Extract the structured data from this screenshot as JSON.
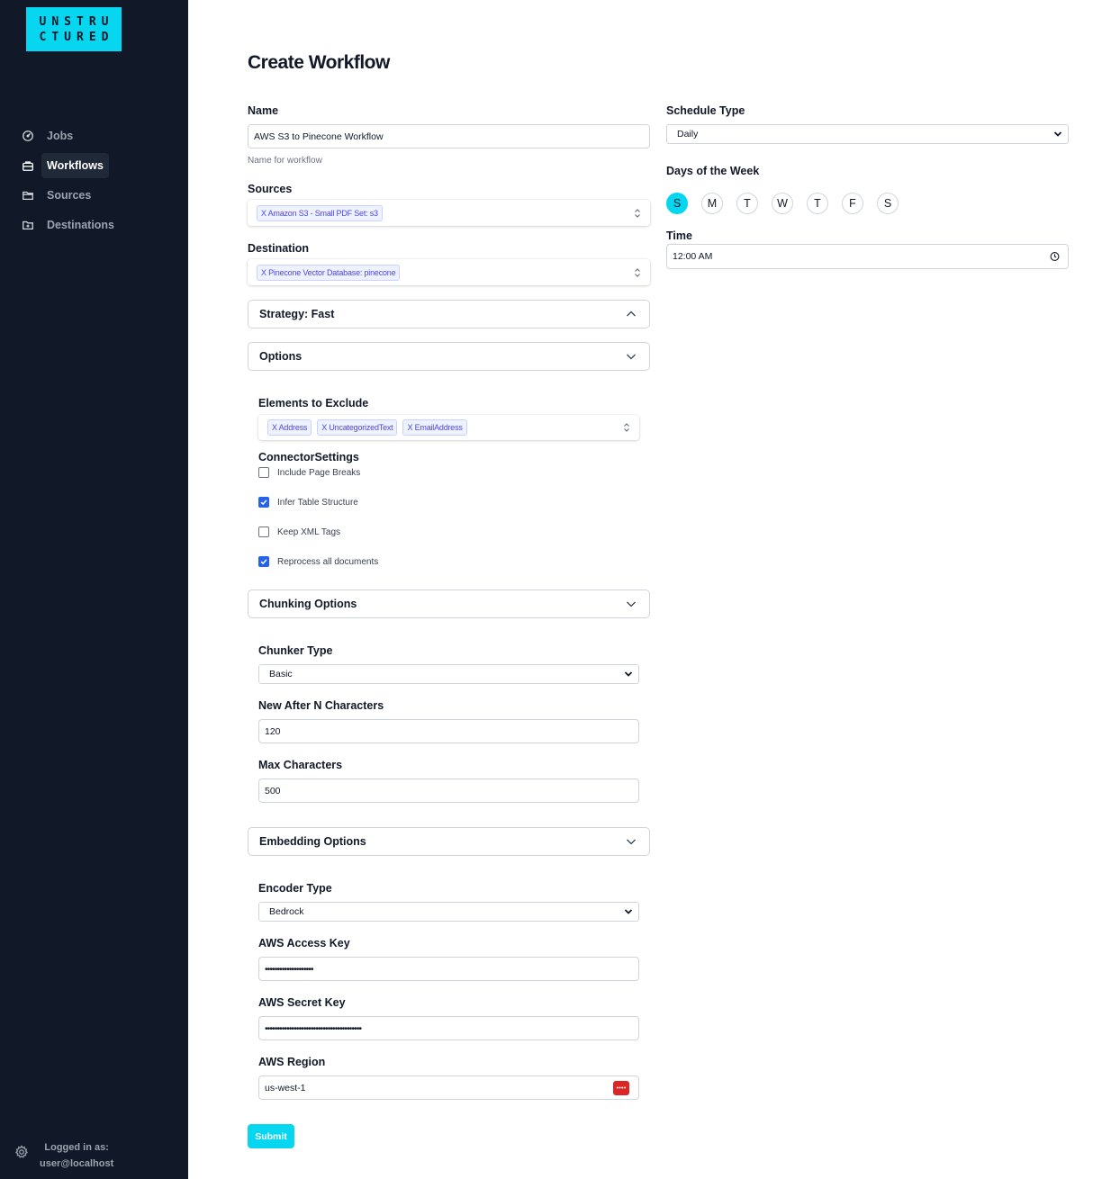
{
  "logo": {
    "line1": "UNSTRU",
    "line2": "CTURED"
  },
  "sidebar": {
    "items": [
      {
        "label": "Jobs",
        "icon": "dashboard-icon",
        "active": false
      },
      {
        "label": "Workflows",
        "icon": "briefcase-icon",
        "active": true
      },
      {
        "label": "Sources",
        "icon": "folder-icon",
        "active": false
      },
      {
        "label": "Destinations",
        "icon": "folder-plus-icon",
        "active": false
      }
    ],
    "footer": {
      "line1": "Logged in as:",
      "line2": "user@localhost"
    }
  },
  "page": {
    "title": "Create Workflow"
  },
  "form": {
    "name": {
      "label": "Name",
      "value": "AWS S3 to Pinecone Workflow",
      "help": "Name for workflow"
    },
    "sources": {
      "label": "Sources",
      "chips": [
        "X Amazon S3 - Small PDF Set: s3"
      ]
    },
    "destination": {
      "label": "Destination",
      "chips": [
        "X Pinecone Vector Database: pinecone"
      ]
    },
    "strategy": {
      "label": "Strategy: Fast"
    },
    "options": {
      "label": "Options"
    },
    "elements_to_exclude": {
      "label": "Elements to Exclude",
      "chips": [
        "X Address",
        "X UncategorizedText",
        "X EmailAddress"
      ]
    },
    "connector_settings": {
      "label": "ConnectorSettings",
      "checkboxes": [
        {
          "label": "Include Page Breaks",
          "checked": false
        },
        {
          "label": "Infer Table Structure",
          "checked": true
        },
        {
          "label": "Keep XML Tags",
          "checked": false
        },
        {
          "label": "Reprocess all documents",
          "checked": true
        }
      ]
    },
    "chunking": {
      "label": "Chunking Options"
    },
    "chunker_type": {
      "label": "Chunker Type",
      "value": "Basic"
    },
    "new_after_n": {
      "label": "New After N Characters",
      "value": "120"
    },
    "max_characters": {
      "label": "Max Characters",
      "value": "500"
    },
    "embedding": {
      "label": "Embedding Options"
    },
    "encoder_type": {
      "label": "Encoder Type",
      "value": "Bedrock"
    },
    "aws_access_key": {
      "label": "AWS Access Key",
      "value": "••••••••••••••••••••"
    },
    "aws_secret_key": {
      "label": "AWS Secret Key",
      "value": "••••••••••••••••••••••••••••••••••••••••"
    },
    "aws_region": {
      "label": "AWS Region",
      "value": "us-west-1"
    },
    "submit": "Submit"
  },
  "schedule": {
    "type": {
      "label": "Schedule Type",
      "value": "Daily"
    },
    "days": {
      "label": "Days of the Week",
      "items": [
        "S",
        "M",
        "T",
        "W",
        "T",
        "F",
        "S"
      ],
      "selected_index": 0
    },
    "time": {
      "label": "Time",
      "value": "12:00 AM"
    }
  },
  "colors": {
    "accent": "#06d6f0",
    "sidebar_bg": "#111827",
    "chip_text": "#4f46e5",
    "checkbox": "#2563eb"
  }
}
